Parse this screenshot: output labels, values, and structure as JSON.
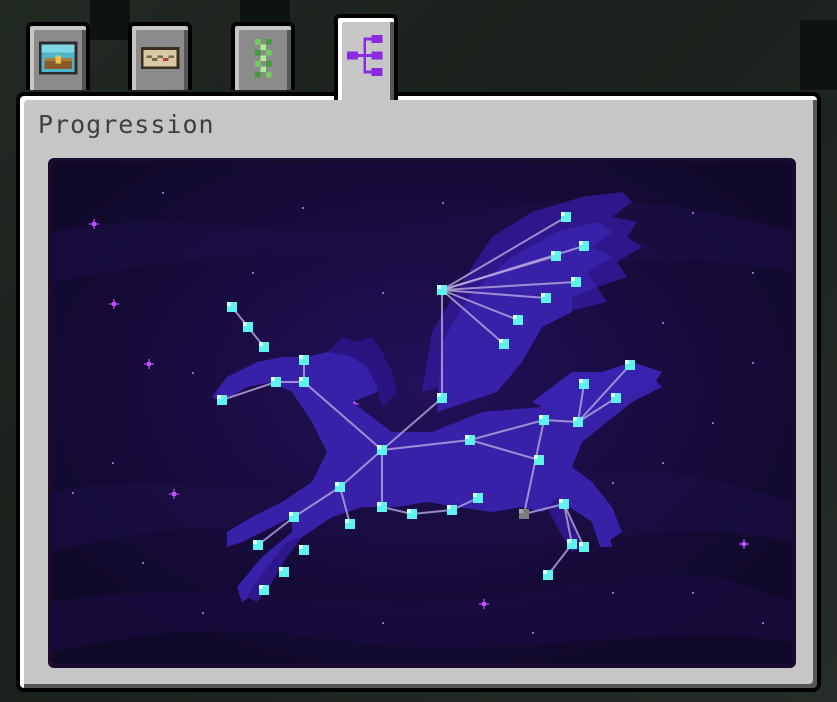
{
  "screen": {
    "title": "Progression"
  },
  "tabs": [
    {
      "id": "tab-inventory",
      "icon": "chest-icon",
      "active": false
    },
    {
      "id": "tab-map",
      "icon": "scroll-map-icon",
      "active": false
    },
    {
      "id": "tab-genetics",
      "icon": "dna-helix-icon",
      "active": false
    },
    {
      "id": "tab-progression",
      "icon": "tree-hierarchy-icon",
      "active": true
    }
  ],
  "constellation": {
    "name": "winged-horse",
    "colors": {
      "unlocked_node": "#5ff3ee",
      "locked_node": "#7c7c7c",
      "link": "#b8a9e0",
      "silhouette": "#3a1d9e",
      "sky": "#140b34",
      "star": "#c050ff"
    }
  }
}
